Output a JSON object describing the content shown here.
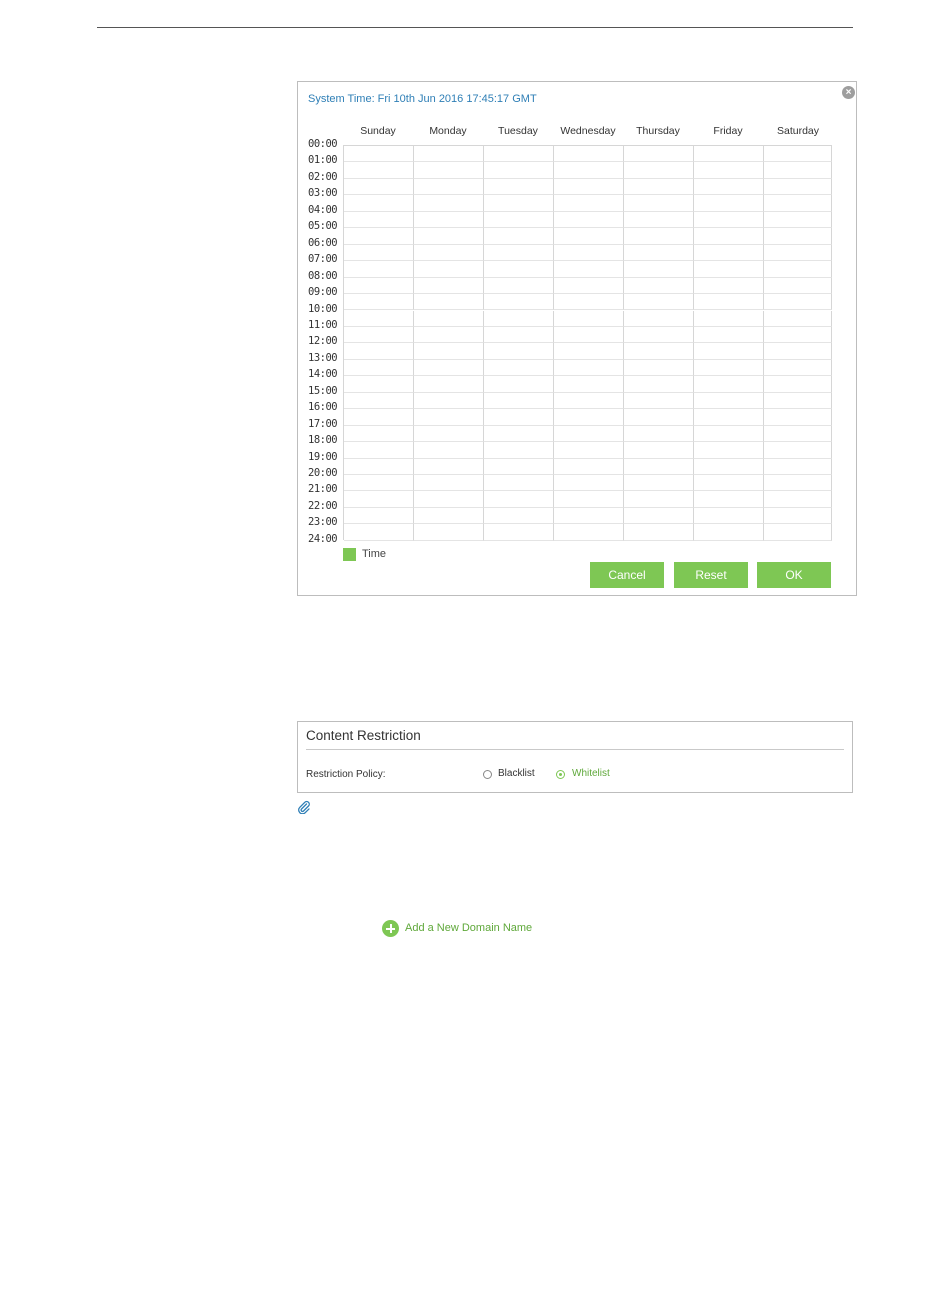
{
  "dialog": {
    "system_time": "System Time: Fri 10th Jun 2016 17:45:17 GMT",
    "close_icon": "close-icon",
    "days": [
      "Sunday",
      "Monday",
      "Tuesday",
      "Wednesday",
      "Thursday",
      "Friday",
      "Saturday"
    ],
    "hours": [
      "00:00",
      "01:00",
      "02:00",
      "03:00",
      "04:00",
      "05:00",
      "06:00",
      "07:00",
      "08:00",
      "09:00",
      "10:00",
      "11:00",
      "12:00",
      "13:00",
      "14:00",
      "15:00",
      "16:00",
      "17:00",
      "18:00",
      "19:00",
      "20:00",
      "21:00",
      "22:00",
      "23:00",
      "24:00"
    ],
    "legend_label": "Time",
    "legend_color": "#7ec754",
    "buttons": {
      "cancel": "Cancel",
      "reset": "Reset",
      "ok": "OK"
    }
  },
  "content_restriction": {
    "title": "Content Restriction",
    "policy_label": "Restriction Policy:",
    "options": [
      {
        "label": "Blacklist",
        "selected": false
      },
      {
        "label": "Whitelist",
        "selected": true
      }
    ],
    "note_icon": "paperclip-icon"
  },
  "add_domain": {
    "label": "Add a New Domain Name",
    "icon": "plus-circle-icon"
  },
  "colors": {
    "accent": "#7ec754",
    "link": "#2f7fb6"
  }
}
